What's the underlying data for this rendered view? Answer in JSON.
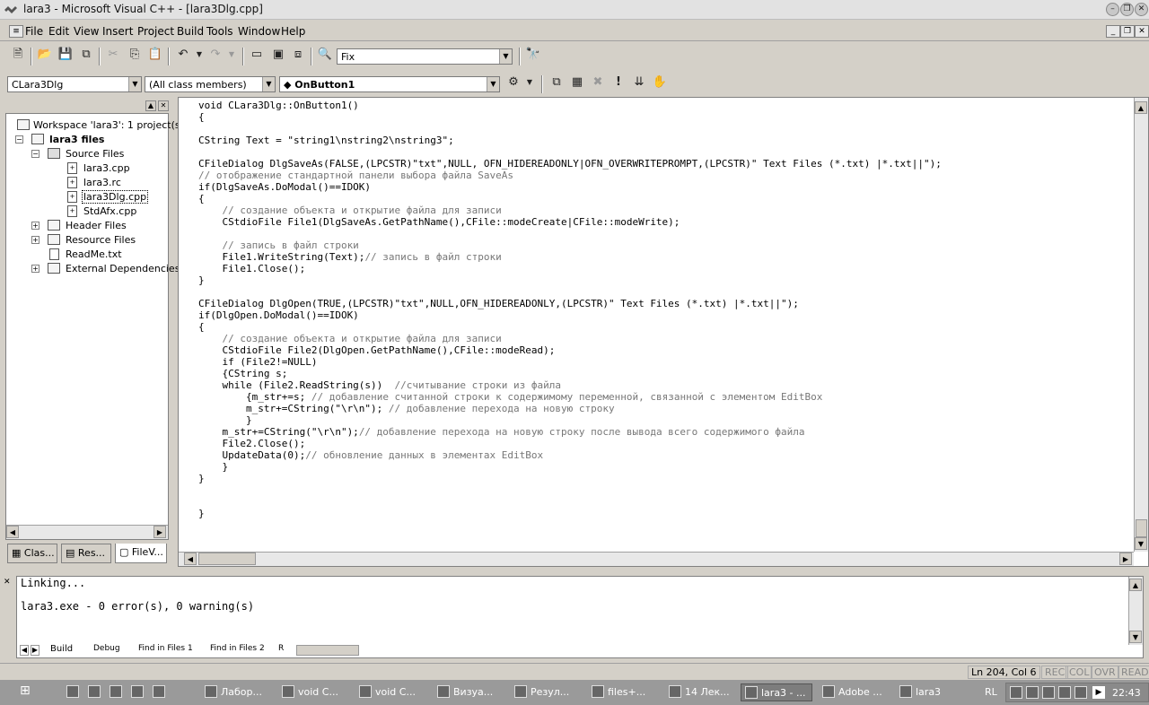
{
  "window": {
    "title": "lara3 - Microsoft Visual C++ - [lara3Dlg.cpp]"
  },
  "menu": [
    "File",
    "Edit",
    "View",
    "Insert",
    "Project",
    "Build",
    "Tools",
    "Window",
    "Help"
  ],
  "toolbar": {
    "find_value": "Fix"
  },
  "wizardbar": {
    "class": "CLara3Dlg",
    "filter": "(All class members)",
    "member": "OnButton1"
  },
  "workspace": {
    "title": "Workspace 'lara3': 1 project(s)",
    "project": "lara3 files",
    "source_folder": "Source Files",
    "files": [
      "lara3.cpp",
      "lara3.rc",
      "lara3Dlg.cpp",
      "StdAfx.cpp"
    ],
    "folders": [
      "Header Files",
      "Resource Files"
    ],
    "readme": "ReadMe.txt",
    "external": "External Dependencies",
    "tabs": [
      "Clas...",
      "Res...",
      "FileV..."
    ]
  },
  "code": {
    "line01": "void CLara3Dlg::OnButton1()",
    "line02": "{",
    "line03": "",
    "line04": "CString Text = \"string1\\nstring2\\nstring3\";",
    "line05": "",
    "line06": "CFileDialog DlgSaveAs(FALSE,(LPCSTR)\"txt\",NULL, OFN_HIDEREADONLY|OFN_OVERWRITEPROMPT,(LPCSTR)\" Text Files (*.txt) |*.txt||\");",
    "line07": "// отображение стандартной панели выбора файла SaveAs",
    "line08": "if(DlgSaveAs.DoModal()==IDOK)",
    "line09": "{",
    "line10": "    // создание объекта и открытие файла для записи",
    "line11": "    CStdioFile File1(DlgSaveAs.GetPathName(),CFile::modeCreate|CFile::modeWrite);",
    "line12": "",
    "line13": "    // запись в файл строки",
    "line14a": "    File1.WriteString(Text);",
    "line14b": "// запись в файл строки",
    "line15": "    File1.Close();",
    "line16": "}",
    "line17": "",
    "line18": "CFileDialog DlgOpen(TRUE,(LPCSTR)\"txt\",NULL,OFN_HIDEREADONLY,(LPCSTR)\" Text Files (*.txt) |*.txt||\");",
    "line19": "if(DlgOpen.DoModal()==IDOK)",
    "line20": "{",
    "line21": "    // создание объекта и открытие файла для записи",
    "line22": "    CStdioFile File2(DlgOpen.GetPathName(),CFile::modeRead);",
    "line23": "    if (File2!=NULL)",
    "line24": "    {CString s;",
    "line25a": "    while (File2.ReadString(s))  ",
    "line25b": "//считывание строки из файла",
    "line26a": "        {m_str+=s; ",
    "line26b": "// добавление считанной строки к содержимому переменной, связанной с элементом EditBox",
    "line27a": "        m_str+=CString(\"\\r\\n\"); ",
    "line27b": "// добавление перехода на новую строку",
    "line28": "        }",
    "line29a": "    m_str+=CString(\"\\r\\n\");",
    "line29b": "// добавление перехода на новую строку после вывода всего содержимого файла",
    "line30": "    File2.Close();",
    "line31a": "    UpdateData(0);",
    "line31b": "// обновление данных в элементах EditBox",
    "line32": "    }",
    "line33": "}",
    "line34": "",
    "line35": "",
    "line36": "}"
  },
  "output": {
    "line1": "Linking...",
    "line2": "",
    "line3": "lara3.exe - 0 error(s), 0 warning(s)",
    "tabs": [
      "Build",
      "Debug",
      "Find in Files 1",
      "Find in Files 2",
      "R"
    ]
  },
  "status": {
    "position": "Ln 204, Col 6",
    "rec": "REC",
    "col": "COL",
    "ovr": "OVR",
    "read": "READ"
  },
  "taskbar": {
    "items": [
      "Лабор...",
      "void C...",
      "void C...",
      "Визуа...",
      "Резул...",
      "files+...",
      "14 Лек...",
      "lara3 - ...",
      "Adobe ...",
      "lara3"
    ],
    "lang": "RL",
    "clock": "22:43"
  }
}
